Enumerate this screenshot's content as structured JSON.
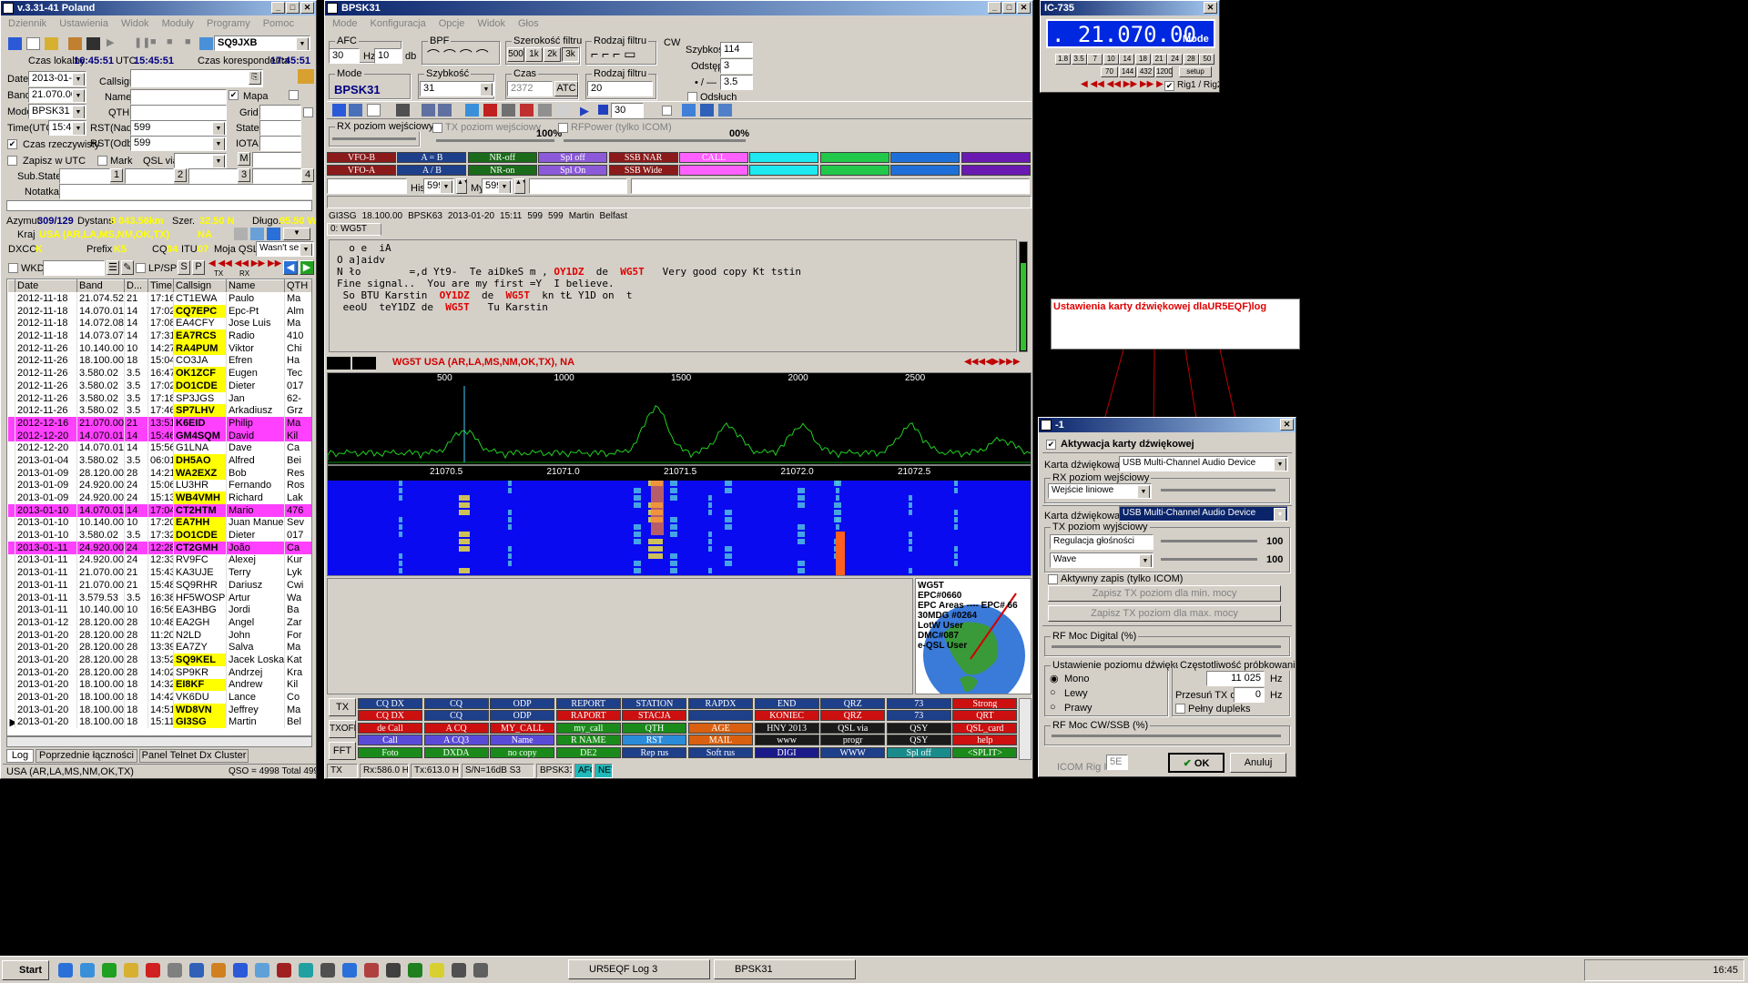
{
  "log": {
    "title": "v.3.31-41 Poland",
    "menu": [
      "Dziennik",
      "Ustawienia",
      "Widok",
      "Moduły",
      "Programy",
      "Pomoc"
    ],
    "callsign_box": "SQ9JXB",
    "local_time_label": "Czas lokalny",
    "local_time": "16:45:51",
    "utc_label": "UTC",
    "utc_time": "15:45:51",
    "corr_time_label": "Czas korespondenta",
    "corr_time": "17:45:51",
    "date_label": "Date",
    "date": "2013-01-27",
    "band_label": "Band",
    "band": "21.070.00",
    "mode_label": "Mode",
    "mode": "BPSK31",
    "time_label": "Time(UTC)",
    "time": "15:45",
    "realtime_label": "Czas rzeczywisty",
    "zapisz_label": "Zapisz w UTC",
    "substate_label": "Sub.State:",
    "notatka_label": "Notatka",
    "callsign_label": "Callsign",
    "name_label": "Name",
    "qth_label": "QTH",
    "rst_nad_label": "RST(Nad)",
    "rst_nad": "599",
    "rst_odb_label": "RST(Odb)",
    "rst_odb": "599",
    "mark_label": "Mark",
    "qslvia_label": "QSL via",
    "mapa_label": "Mapa",
    "grid_label": "Grid",
    "state_label": "State",
    "iota_label": "IOTA",
    "m_label": "M",
    "sub_btns": [
      "1",
      "2",
      "3",
      "4"
    ],
    "azimut_label": "Azymut",
    "azimut": "309/129",
    "dystans_label": "Dystans",
    "dystans": "8 043.56km",
    "szer_label": "Szer.",
    "szer": "32.50 N",
    "dlug_label": "Długo.",
    "dlug": "95.50 W",
    "kraj_label": "Kraj",
    "kraj": "USA (AR,LA,MS,NM,OK,TX)",
    "kraj_cont": "NA",
    "dxcc_label": "DXCC",
    "dxcc": "K",
    "prefix_label": "Prefix",
    "prefix": "K5",
    "cq_label": "CQ",
    "cq": "04",
    "itu_label": "ITU",
    "itu": "07",
    "mojaqsl_label": "Moja QSL",
    "mojaqsl": "Wasn't sent",
    "wkd_label": "WKD",
    "lpsp_label": "LP/SP",
    "s_btn": "S",
    "p_btn": "P",
    "tx_small": "TX",
    "rx_small": "RX",
    "columns": [
      "Date",
      "Band",
      "D...",
      "Time",
      "Callsign",
      "Name",
      "QTH"
    ],
    "rows": [
      [
        "2012-11-18",
        "21.074.52",
        "21",
        "17:16",
        "CT1EWA",
        "Paulo",
        "Ma",
        ""
      ],
      [
        "2012-11-18",
        "14.070.01",
        "14",
        "17:02",
        "CQ7EPC",
        "Epc-Pt",
        "Alm",
        "y"
      ],
      [
        "2012-11-18",
        "14.072.08",
        "14",
        "17:08",
        "EA4CFY",
        "Jose Luis",
        "Ma",
        ""
      ],
      [
        "2012-11-18",
        "14.073.07",
        "14",
        "17:31",
        "EA7RCS",
        "Radio",
        "410",
        "y"
      ],
      [
        "2012-11-26",
        "10.140.00",
        "10",
        "14:27",
        "RA4PUM",
        "Viktor",
        "Chi",
        "y"
      ],
      [
        "2012-11-26",
        "18.100.00",
        "18",
        "15:04",
        "CO3JA",
        "Efren",
        "Ha",
        ""
      ],
      [
        "2012-11-26",
        "3.580.02",
        "3.5",
        "16:47",
        "OK1ZCF",
        "Eugen",
        "Tec",
        "y"
      ],
      [
        "2012-11-26",
        "3.580.02",
        "3.5",
        "17:02",
        "DO1CDE",
        "Dieter",
        "017",
        "y"
      ],
      [
        "2012-11-26",
        "3.580.02",
        "3.5",
        "17:18",
        "SP3JGS",
        "Jan",
        "62-",
        ""
      ],
      [
        "2012-11-26",
        "3.580.02",
        "3.5",
        "17:46",
        "SP7LHV",
        "Arkadiusz",
        "Grz",
        "y"
      ],
      [
        "2012-12-16",
        "21.070.00",
        "21",
        "13:51",
        "K6EID",
        "Philip",
        "Ma",
        "p"
      ],
      [
        "2012-12-20",
        "14.070.01",
        "14",
        "15:46",
        "GM4SQM",
        "David",
        "Kil",
        "p"
      ],
      [
        "2012-12-20",
        "14.070.01",
        "14",
        "15:56",
        "G1LNA",
        "Dave",
        "Ca",
        ""
      ],
      [
        "2013-01-04",
        "3.580.02",
        "3.5",
        "06:01",
        "DH5AO",
        "Alfred",
        "Bei",
        "y"
      ],
      [
        "2013-01-09",
        "28.120.00",
        "28",
        "14:21",
        "WA2EXZ",
        "Bob",
        "Res",
        "y"
      ],
      [
        "2013-01-09",
        "24.920.00",
        "24",
        "15:06",
        "LU3HR",
        "Fernando",
        "Ros",
        ""
      ],
      [
        "2013-01-09",
        "24.920.00",
        "24",
        "15:13",
        "WB4VMH",
        "Richard",
        "Lak",
        "y"
      ],
      [
        "2013-01-10",
        "14.070.01",
        "14",
        "17:04",
        "CT2HTM",
        "Mario",
        "476",
        "p"
      ],
      [
        "2013-01-10",
        "10.140.00",
        "10",
        "17:20",
        "EA7HH",
        "Juan Manuel",
        "Sev",
        "y"
      ],
      [
        "2013-01-10",
        "3.580.02",
        "3.5",
        "17:32",
        "DO1CDE",
        "Dieter",
        "017",
        "y"
      ],
      [
        "2013-01-11",
        "24.920.00",
        "24",
        "12:28",
        "CT2GMH",
        "João",
        "Ca",
        "p"
      ],
      [
        "2013-01-11",
        "24.920.00",
        "24",
        "12:33",
        "RV9FC",
        "Alexej",
        "Kur",
        ""
      ],
      [
        "2013-01-11",
        "21.070.00",
        "21",
        "15:43",
        "KA3UJE",
        "Terry",
        "Lyk",
        ""
      ],
      [
        "2013-01-11",
        "21.070.00",
        "21",
        "15:48",
        "SQ9RHR",
        "Dariusz",
        "Cwi",
        ""
      ],
      [
        "2013-01-11",
        "3.579.53",
        "3.5",
        "16:38",
        "HF5WOSP",
        "Artur",
        "Wa",
        ""
      ],
      [
        "2013-01-11",
        "10.140.00",
        "10",
        "16:56",
        "EA3HBG",
        "Jordi",
        "Ba",
        ""
      ],
      [
        "2013-01-12",
        "28.120.00",
        "28",
        "10:48",
        "EA2GH",
        "Angel",
        "Zar",
        ""
      ],
      [
        "2013-01-20",
        "28.120.00",
        "28",
        "11:20",
        "N2LD",
        "John",
        "For",
        ""
      ],
      [
        "2013-01-20",
        "28.120.00",
        "28",
        "13:39",
        "EA7ZY",
        "Salva",
        "Ma",
        ""
      ],
      [
        "2013-01-20",
        "28.120.00",
        "28",
        "13:52",
        "SQ9KEL",
        "Jacek Loska",
        "Kat",
        "y"
      ],
      [
        "2013-01-20",
        "28.120.00",
        "28",
        "14:02",
        "SP9KR",
        "Andrzej",
        "Kra",
        ""
      ],
      [
        "2013-01-20",
        "18.100.00",
        "18",
        "14:32",
        "EI8KF",
        "Andrew",
        "Kil",
        "y"
      ],
      [
        "2013-01-20",
        "18.100.00",
        "18",
        "14:42",
        "VK6DU",
        "Lance",
        "Co",
        ""
      ],
      [
        "2013-01-20",
        "18.100.00",
        "18",
        "14:51",
        "WD8VN",
        "Jeffrey",
        "Ma",
        "y"
      ],
      [
        "2013-01-20",
        "18.100.00",
        "18",
        "15:11",
        "GI3SG",
        "Martin",
        "Bel",
        "y"
      ]
    ],
    "tabs": [
      "Log",
      "Poprzednie łączności",
      "Panel Telnet Dx Cluster"
    ],
    "status_left": "USA (AR,LA,MS,NM,OK,TX)",
    "status_right": "QSO = 4998 Total 4998"
  },
  "bpsk": {
    "title": "BPSK31",
    "menu": [
      "Mode",
      "Konfiguracja",
      "Opcje",
      "Widok",
      "Głos"
    ],
    "afc_label": "AFC",
    "afc_val": "30",
    "hz_label": "Hz",
    "afc2": "10",
    "db_label": "db",
    "bpf_label": "BPF",
    "szer_filtra_label": "Szerokość filtru",
    "filter_widths": [
      "500",
      "1k",
      "2k",
      "3k"
    ],
    "rodzaj_filtru_label": "Rodzaj filtru",
    "cw_label": "CW",
    "szybkosc_label": "Szybkość",
    "szybkosc": "114",
    "odstep_label": "Odstęp",
    "odstep": "3",
    "cw_extra": "3.5",
    "cw_extra_label": "• / —",
    "odsluch_label": "Odsłuch",
    "mode_label": "Mode",
    "mode_val": "BPSK31",
    "speed_label": "Szybkość",
    "speed_val": "31",
    "czas_label": "Czas",
    "czas_val": "2372",
    "atc_label": "ATC",
    "rodzaj2_label": "Rodzaj filtru",
    "rodzaj2_val": "20",
    "tb_num": "30",
    "rx_poziom": "RX poziom wejściowy",
    "tx_poziom": "TX poziom wejściowy",
    "tx_pct": "100%",
    "rfpower": "RFPower (tylko ICOM)",
    "rf_pct": "00%",
    "macro_row1": [
      [
        "VFO-B",
        "#8b1a1a"
      ],
      [
        "A = B",
        "#1e3f8a"
      ],
      [
        "NR-off",
        "#1a6b1a"
      ],
      [
        "Spl off",
        "#8c5ad8"
      ],
      [
        "SSB NAR",
        "#8b1a1a"
      ],
      [
        "CALL",
        "#ff60ff"
      ],
      [
        "",
        "#1ee8f0"
      ],
      [
        "",
        "#22c84a"
      ],
      [
        "",
        "#1e70d8"
      ],
      [
        "",
        "#6a1ab0"
      ]
    ],
    "macro_row2": [
      [
        "VFO-A",
        "#8b1a1a"
      ],
      [
        "A / B",
        "#1e3f8a"
      ],
      [
        "NR-on",
        "#1a6b1a"
      ],
      [
        "Spl On",
        "#8c5ad8"
      ],
      [
        "SSB Wide",
        "#8b1a1a"
      ],
      [
        "",
        "#ff60ff"
      ],
      [
        "",
        "#1ee8f0"
      ],
      [
        "",
        "#22c84a"
      ],
      [
        "",
        "#1e70d8"
      ],
      [
        "",
        "#6a1ab0"
      ]
    ],
    "his_label": "His",
    "his_val": "599",
    "my_label": "My",
    "my_val": "599",
    "info_row": [
      "GI3SG",
      "18.100.00",
      "BPSK63",
      "2013-01-20",
      "15:11",
      "599",
      "599",
      "Martin",
      "Belfast"
    ],
    "rx_tab": "0: WG5T",
    "rx_lines": [
      [
        [
          "  o e  iA",
          ""
        ]
      ],
      [
        [
          "O a]aidv",
          ""
        ]
      ],
      [
        [
          "N ło        =,d Yt9-  Te aiDkeS m , ",
          ""
        ],
        [
          "OY1DZ",
          "r"
        ],
        [
          "  de  ",
          ""
        ],
        [
          "WG5T",
          "r"
        ],
        [
          "   Very good copy Kt tstin",
          ""
        ]
      ],
      [
        [
          "Fine signal..  You are my first =Y  I believe.",
          ""
        ]
      ],
      [
        [
          " So BTU Karstin  ",
          ""
        ],
        [
          "OY1DZ",
          "r"
        ],
        [
          "  de  ",
          ""
        ],
        [
          "WG5T",
          "r"
        ],
        [
          "  kn tŁ Y1D on  t",
          ""
        ]
      ],
      [
        [
          " eeoU  teY1DZ de  ",
          ""
        ],
        [
          "WG5T",
          "r"
        ],
        [
          "   Tu Karstin",
          ""
        ]
      ]
    ],
    "dx_info": "WG5T USA (AR,LA,MS,NM,OK,TX), NA",
    "scale_hz": [
      "500",
      "1000",
      "1500",
      "2000",
      "2500"
    ],
    "scale_khz": [
      "21070.5",
      "21071.0",
      "21071.5",
      "21072.0",
      "21072.5"
    ],
    "globe_lines": [
      "WG5T",
      "EPC#0660",
      "EPC Areas   ----  EPC# 66",
      "30MDG #0264",
      "LotW User",
      "DMC#087",
      "e-QSL User"
    ],
    "tx_btn": "TX",
    "txoff_btn": "TXOFF",
    "fft_btn": "FFT",
    "macros": [
      [
        [
          "CQ DX",
          "#1e3f8a"
        ],
        [
          "CQ",
          "#1e3f8a"
        ],
        [
          "ODP",
          "#1e3f8a"
        ],
        [
          "REPORT",
          "#1e3f8a"
        ],
        [
          "STATION",
          "#1e3f8a"
        ],
        [
          "RAPDX",
          "#1e3f8a"
        ],
        [
          "END",
          "#1e3f8a"
        ],
        [
          "QRZ",
          "#1e3f8a"
        ],
        [
          "73",
          "#1e3f8a"
        ],
        [
          "Strong",
          "#cc1010"
        ]
      ],
      [
        [
          "CQ DX",
          "#cc1010"
        ],
        [
          "CQ",
          "#1e3f8a"
        ],
        [
          "ODP",
          "#1e3f8a"
        ],
        [
          "RAPORT",
          "#cc1010"
        ],
        [
          "STACJA",
          "#cc1010"
        ],
        [
          "",
          "#1e3f8a"
        ],
        [
          "KONIEC",
          "#cc1010"
        ],
        [
          "QRZ",
          "#cc1010"
        ],
        [
          "73",
          "#1e3f8a"
        ],
        [
          "QRT",
          "#cc1010"
        ]
      ],
      [
        [
          "de Call",
          "#cc1010"
        ],
        [
          "A CQ",
          "#cc1010"
        ],
        [
          "MY_CALL",
          "#cc1010"
        ],
        [
          "my_call",
          "#1a8b1a"
        ],
        [
          "QTH",
          "#1a8b1a"
        ],
        [
          "AGE",
          "#d86010"
        ],
        [
          "HNY 2013",
          "#1a1a1a"
        ],
        [
          "QSL via",
          "#1a1a1a"
        ],
        [
          "QSY",
          "#1a1a1a"
        ],
        [
          "QSL_card",
          "#cc1010"
        ]
      ],
      [
        [
          "Call",
          "#5a4ad8"
        ],
        [
          "A CQ3",
          "#5a4ad8"
        ],
        [
          "Name",
          "#5a4ad8"
        ],
        [
          "R NAME",
          "#1a8b1a"
        ],
        [
          "RST",
          "#2a8bd8"
        ],
        [
          "MAIL",
          "#d86010"
        ],
        [
          "www",
          "#1a1a1a"
        ],
        [
          "progr",
          "#1a1a1a"
        ],
        [
          "QSY",
          "#1a1a1a"
        ],
        [
          "help",
          "#cc1010"
        ]
      ],
      [
        [
          "Foto",
          "#1a8b1a"
        ],
        [
          "DXDA",
          "#1a8b1a"
        ],
        [
          "no copy",
          "#1a8b1a"
        ],
        [
          "DE2",
          "#1a8b1a"
        ],
        [
          "Rep rus",
          "#1e3f8a"
        ],
        [
          "Soft rus",
          "#1e3f8a"
        ],
        [
          "DIGI",
          "#1a1a8b"
        ],
        [
          "WWW",
          "#1e3f8a"
        ],
        [
          "Spl off",
          "#1a8b8b"
        ],
        [
          "<SPLIT>",
          "#1a8b1a"
        ]
      ]
    ],
    "status": [
      "TX",
      "Rx:586.0 Hz",
      "Tx:613.0 Hz",
      "S/N=16dB S3",
      "BPSK31",
      "AFC",
      "NET"
    ]
  },
  "ic": {
    "title": "IC-735",
    "freq": ". 21.070.00",
    "mode": "Mode",
    "bands1": [
      "1.8",
      "3.5",
      "7",
      "10",
      "14",
      "18",
      "21",
      "24",
      "28",
      "50"
    ],
    "bands2": [
      "70",
      "144",
      "432",
      "1200",
      "setup"
    ],
    "rig_label": "Rig1 / Rig2"
  },
  "annotation": {
    "text": "Ustawienia karty dźwiękowej dlaUR5EQF)log"
  },
  "snd": {
    "title": "-1",
    "aktyw_label": "Aktywacja karty dźwiękowej",
    "karta_label": "Karta dźwiękowa",
    "karta1": "USB Multi-Channel Audio Device",
    "rx_grp": "RX poziom wejściowy",
    "rx_input": "Wejście liniowe",
    "karta2": "USB Multi-Channel Audio Device",
    "tx_grp": "TX poziom wyjściowy",
    "tx1": "Regulacja głośności",
    "tx1_val": "100",
    "tx2": "Wave",
    "tx2_val": "100",
    "aktywny_label": "Aktywny zapis (tylko ICOM)",
    "zapisz_min": "Zapisz TX poziom dla min. mocy",
    "zapisz_max": "Zapisz TX poziom dla max. mocy",
    "rfmoc_label": "RF Moc Digital (%)",
    "ustaw_label": "Ustawienie poziomu dźwięku",
    "mono": "Mono",
    "lewy": "Lewy",
    "prawy": "Prawy",
    "czest_label": "Częstotliwość próbkowania",
    "czest_val": "11 025",
    "hz": "Hz",
    "przesun_label": "Przesuń TX o",
    "przesun_val": "0",
    "dupleks": "Pełny dupleks",
    "rfcw_label": "RF Moc CW/SSB (%)",
    "icom_label": "ICOM Rig ID",
    "icom_val": "5E",
    "ok": "OK",
    "cancel": "Anuluj"
  },
  "taskbar": {
    "start": "Start",
    "items": [
      "UR5EQF Log 3",
      "BPSK31"
    ],
    "clock": "16:45"
  }
}
